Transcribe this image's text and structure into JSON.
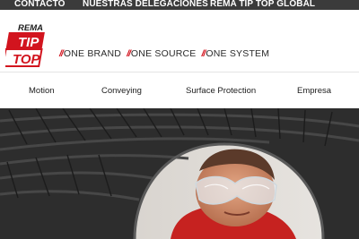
{
  "topbar": {
    "links": [
      "CONTACTO",
      "NUESTRAS DELEGACIONES",
      "REMA TIP TOP GLOBAL"
    ]
  },
  "brand": {
    "logo_line1": "REMA",
    "logo_line2": "TIP",
    "logo_line3": "TOP",
    "tagline": [
      "ONE BRAND",
      "ONE SOURCE",
      "ONE SYSTEM"
    ],
    "slash": "//"
  },
  "nav": {
    "items": [
      "Motion",
      "Conveying",
      "Surface Protection",
      "Empresa"
    ]
  },
  "colors": {
    "brand_red": "#d2141e",
    "topbar": "#3b3b3b"
  },
  "hero": {
    "image": "tire-inspection-photo"
  }
}
